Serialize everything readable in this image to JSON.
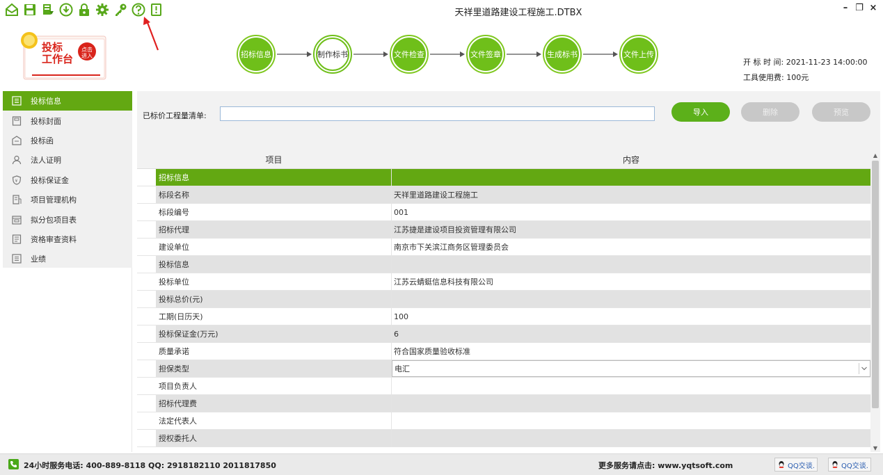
{
  "window": {
    "title": "天祥里道路建设工程施工.DTBX",
    "minimize": "–",
    "restore": "❐",
    "close": "×"
  },
  "toolbar": {
    "icons": [
      "home-icon",
      "save-icon",
      "export-icon",
      "download-icon",
      "lock-icon",
      "gear-icon",
      "key-icon",
      "help-icon",
      "edit-doc-icon"
    ]
  },
  "logo": {
    "line1": "投标",
    "line2": "工作台",
    "badge": "点击进入"
  },
  "workflow": {
    "steps": [
      {
        "label": "招标信息",
        "active": false
      },
      {
        "label": "制作标书",
        "active": true
      },
      {
        "label": "文件检查",
        "active": false
      },
      {
        "label": "文件签章",
        "active": false
      },
      {
        "label": "生成标书",
        "active": false
      },
      {
        "label": "文件上传",
        "active": false
      }
    ]
  },
  "header_info": {
    "open_time_label": "开 标 时 间:",
    "open_time_value": "2021-11-23 14:00:00",
    "fee_label": "工具使用费:",
    "fee_value": "100元"
  },
  "sidebar": {
    "items": [
      {
        "label": "投标信息",
        "icon": "list-icon"
      },
      {
        "label": "投标封面",
        "icon": "cover-icon"
      },
      {
        "label": "投标函",
        "icon": "letter-icon"
      },
      {
        "label": "法人证明",
        "icon": "person-icon"
      },
      {
        "label": "投标保证金",
        "icon": "shield-icon"
      },
      {
        "label": "项目管理机构",
        "icon": "building-icon"
      },
      {
        "label": "拟分包项目表",
        "icon": "folder-icon"
      },
      {
        "label": "资格审查资料",
        "icon": "document-icon"
      },
      {
        "label": "业绩",
        "icon": "record-icon"
      }
    ]
  },
  "import": {
    "label": "已标价工程量清单:",
    "value": "",
    "import_btn": "导入",
    "delete_btn": "删除",
    "preview_btn": "预览"
  },
  "grid": {
    "col_item": "项目",
    "col_content": "内容",
    "rows": [
      {
        "item": "招标信息",
        "content": "",
        "kind": "group"
      },
      {
        "item": "标段名称",
        "content": "天祥里道路建设工程施工",
        "kind": "alt"
      },
      {
        "item": "标段编号",
        "content": "001",
        "kind": "plain"
      },
      {
        "item": "招标代理",
        "content": "江苏捷是建设项目投资管理有限公司",
        "kind": "alt"
      },
      {
        "item": "建设单位",
        "content": "南京市下关滨江商务区管理委员会",
        "kind": "plain"
      },
      {
        "item": "投标信息",
        "content": "",
        "kind": "alt"
      },
      {
        "item": "投标单位",
        "content": "江苏云蜻蜓信息科技有限公司",
        "kind": "plain"
      },
      {
        "item": "投标总价(元)",
        "content": "",
        "kind": "alt"
      },
      {
        "item": "工期(日历天)",
        "content": "100",
        "kind": "plain"
      },
      {
        "item": "投标保证金(万元)",
        "content": "6",
        "kind": "alt"
      },
      {
        "item": "质量承诺",
        "content": "符合国家质量验收标准",
        "kind": "plain"
      },
      {
        "item": "担保类型",
        "content": "电汇",
        "kind": "select"
      },
      {
        "item": "项目负责人",
        "content": "",
        "kind": "plain"
      },
      {
        "item": "招标代理费",
        "content": "",
        "kind": "alt"
      },
      {
        "item": "法定代表人",
        "content": "",
        "kind": "plain"
      },
      {
        "item": "授权委托人",
        "content": "",
        "kind": "alt"
      }
    ]
  },
  "statusbar": {
    "left": "24小时服务电话: 400-889-8118  QQ: 2918182110  2011817850",
    "right": "更多服务请点击: www.yqtsoft.com",
    "qq1": "QQ交谈.",
    "qq2": "QQ交谈."
  },
  "colors": {
    "accent": "#63a812",
    "step": "#6fbf1a",
    "annotation": "#e02020"
  }
}
